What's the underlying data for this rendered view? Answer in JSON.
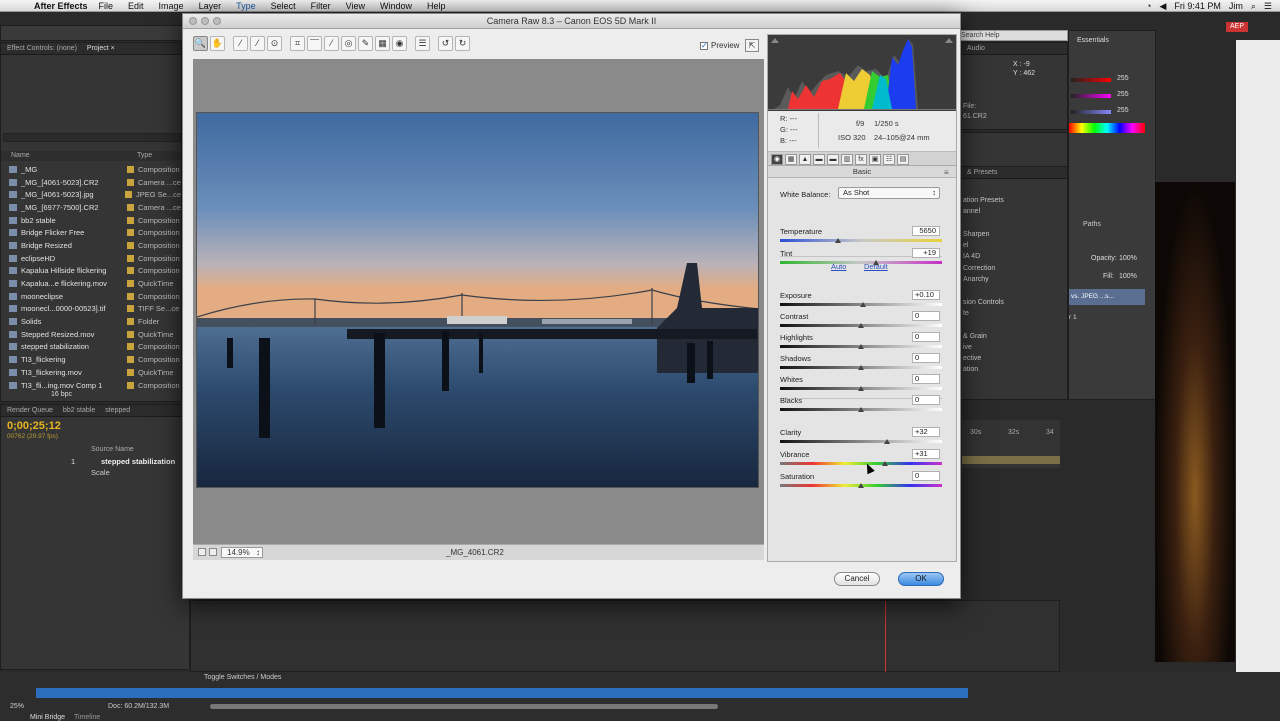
{
  "menubar": {
    "app": "After Effects",
    "items": [
      "File",
      "Edit",
      "Image",
      "Layer",
      "Type",
      "Select",
      "Filter",
      "View",
      "Window",
      "Help"
    ],
    "active_item": "Type",
    "clock": "Fri 9:41 PM",
    "user": "Jim"
  },
  "ae": {
    "effect_controls_tab": "Effect Controls: (none)",
    "project_tab": "Project ×",
    "col_name": "Name",
    "col_type": "Type",
    "project_items": [
      {
        "name": "_MG",
        "type": "Composition"
      },
      {
        "name": "_MG_[4061-5023].CR2",
        "type": "Camera ...ce"
      },
      {
        "name": "_MG_[4061-5023].jpg",
        "type": "JPEG Se...ce"
      },
      {
        "name": "_MG_[6977-7500].CR2",
        "type": "Camera ...ce"
      },
      {
        "name": "bb2 stable",
        "type": "Composition"
      },
      {
        "name": "Bridge Flicker Free",
        "type": "Composition"
      },
      {
        "name": "Bridge Resized",
        "type": "Composition"
      },
      {
        "name": "eclipseHD",
        "type": "Composition"
      },
      {
        "name": "Kapalua Hillside flickering",
        "type": "Composition"
      },
      {
        "name": "Kapalua...e flickering.mov",
        "type": "QuickTime"
      },
      {
        "name": "mooneclipse",
        "type": "Composition"
      },
      {
        "name": "moonecl...0000-00523].tif",
        "type": "TIFF Se...ce"
      },
      {
        "name": "Solids",
        "type": "Folder"
      },
      {
        "name": "Stepped Resized.mov",
        "type": "QuickTime"
      },
      {
        "name": "stepped stabilization",
        "type": "Composition"
      },
      {
        "name": "TI3_flickering",
        "type": "Composition"
      },
      {
        "name": "TI3_flickering.mov",
        "type": "QuickTime"
      },
      {
        "name": "TI3_fli...ing.mov Comp 1",
        "type": "Composition"
      }
    ],
    "bpc": "16 bpc",
    "render_queue_tab": "Render Queue",
    "comp_tab_1": "bb2 stable",
    "comp_tab_2": "stepped",
    "timecode": "0;00;25;12",
    "frames": "00762 (29.97 fps)",
    "source_name_col": "Source Name",
    "layer_name": "stepped stabilization",
    "layer_num": "1",
    "property": "Scale",
    "toggle_switches": "Toggle Switches / Modes",
    "zoom": "25%",
    "doc_size": "Doc: 60.2M/132.3M",
    "mini_bridge": "Mini Bridge",
    "timeline": "Timeline",
    "essentials": "Essentials",
    "search_help": "Search Help",
    "audio_tab": "Audio",
    "coords_x": "X : -9",
    "coords_y": "Y : 462",
    "file_label": "File:",
    "file_name": "61.CR2",
    "rgb_values": [
      "255",
      "255",
      "255"
    ],
    "presets_tab": "& Presets",
    "presets": [
      "ation Presets",
      "annel",
      "",
      "Sharpen",
      "el",
      "IA 4D",
      "Correction",
      "Anarchy",
      "",
      "sion Controls",
      "te",
      "",
      "& Grain",
      "ive",
      "ective",
      "ation"
    ],
    "paths_tab": "Paths",
    "opacity_label": "Opacity:",
    "opacity": "100%",
    "fill_label": "Fill:",
    "fill": "100%",
    "layer_item": "vs. JPEG ...s...",
    "layer_item_2": "r 1",
    "ruler_labels": [
      "30s",
      "32s",
      "34"
    ],
    "aep": "AEP"
  },
  "dialog": {
    "title": "Camera Raw 8.3  –  Canon EOS 5D Mark II",
    "preview_label": "Preview",
    "preview_checked": true,
    "zoom_value": "14.9%",
    "filename": "_MG_4061.CR2",
    "cancel_label": "Cancel",
    "ok_label": "OK",
    "tools": [
      "zoom-icon",
      "hand-icon",
      "eyedropper-icon",
      "color-sampler-icon",
      "target-adjust-icon",
      "crop-icon",
      "straighten-icon",
      "spot-removal-icon",
      "red-eye-icon",
      "adjustment-brush-icon",
      "graduated-filter-icon",
      "radial-filter-icon",
      "preferences-icon",
      "rotate-left-icon",
      "rotate-right-icon"
    ],
    "tool_glyphs": [
      "🔍",
      "✋",
      "⁄",
      "⁄",
      "⊙",
      "⌗",
      "⎺",
      "⁄",
      "◎",
      "✎",
      "▦",
      "◉",
      "☰",
      "↺",
      "↻"
    ]
  },
  "info": {
    "r": "R:  ---",
    "g": "G:  ---",
    "b": "B:  ---",
    "aperture": "f/9",
    "shutter": "1/250 s",
    "iso": "ISO 320",
    "lens": "24–105@24 mm"
  },
  "basic_panel": {
    "title": "Basic",
    "white_balance_label": "White Balance:",
    "white_balance_value": "As Shot",
    "auto_label": "Auto",
    "default_label": "Default",
    "sliders": [
      {
        "label": "Temperature",
        "value": "5650",
        "pos": 0.36,
        "kind": "temp"
      },
      {
        "label": "Tint",
        "value": "+19",
        "pos": 0.59,
        "kind": "tint"
      },
      {
        "label": "Exposure",
        "value": "+0.10",
        "pos": 0.51,
        "kind": "tone"
      },
      {
        "label": "Contrast",
        "value": "0",
        "pos": 0.5,
        "kind": "tone"
      },
      {
        "label": "Highlights",
        "value": "0",
        "pos": 0.5,
        "kind": "tone"
      },
      {
        "label": "Shadows",
        "value": "0",
        "pos": 0.5,
        "kind": "tone"
      },
      {
        "label": "Whites",
        "value": "0",
        "pos": 0.5,
        "kind": "tone"
      },
      {
        "label": "Blacks",
        "value": "0",
        "pos": 0.5,
        "kind": "tone"
      },
      {
        "label": "Clarity",
        "value": "+32",
        "pos": 0.66,
        "kind": "tone"
      },
      {
        "label": "Vibrance",
        "value": "+31",
        "pos": 0.65,
        "kind": "vib"
      },
      {
        "label": "Saturation",
        "value": "0",
        "pos": 0.5,
        "kind": "sat"
      }
    ]
  }
}
